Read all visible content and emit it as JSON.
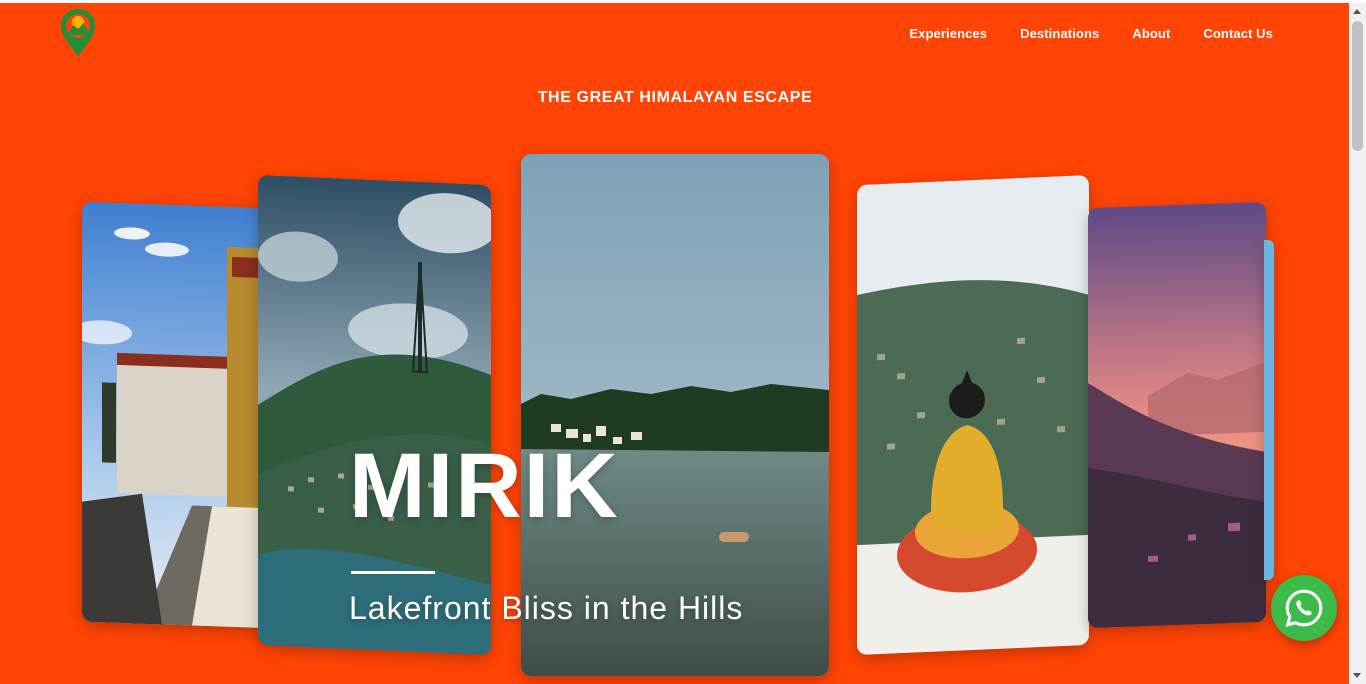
{
  "header": {
    "logo_icon": "map-pin-mountain-logo",
    "nav": [
      {
        "label": "Experiences"
      },
      {
        "label": "Destinations"
      },
      {
        "label": "About"
      },
      {
        "label": "Contact Us"
      }
    ]
  },
  "hero": {
    "tagline": "THE GREAT HIMALAYAN ESCAPE",
    "title": "MIRIK",
    "subtitle": "Lakefront Bliss in the Hills",
    "cards": [
      {
        "scene": "monastery-stupas"
      },
      {
        "scene": "hill-town-with-tower"
      },
      {
        "scene": "mirik-lake"
      },
      {
        "scene": "golden-buddha-statue"
      },
      {
        "scene": "mountain-sunset"
      },
      {
        "scene": "partial-card"
      }
    ]
  },
  "whatsapp": {
    "icon": "whatsapp-icon"
  },
  "colors": {
    "background": "#ff4405",
    "text": "#ffffff",
    "whatsapp": "#3dbb4a",
    "logo_green": "#1f8f3a"
  }
}
